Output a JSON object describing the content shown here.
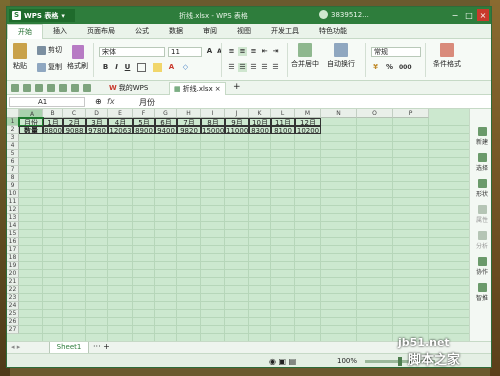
{
  "window": {
    "brand": "WPS 表格",
    "title": "折线.xlsx - WPS 表格",
    "user": "3839512...",
    "controls": [
      "minimize",
      "maximize",
      "close"
    ]
  },
  "menus": [
    "开始",
    "插入",
    "页面布局",
    "公式",
    "数据",
    "审阅",
    "视图",
    "开发工具",
    "特色功能"
  ],
  "ribbon": {
    "paste_label": "粘贴",
    "cut_label": "剪切",
    "copy_label": "复制",
    "format_painter_label": "格式刷",
    "font_name": "宋体",
    "font_size": "11",
    "merge_label": "合并居中",
    "wrap_label": "自动换行",
    "number_format": "常规",
    "conditional_format_label": "条件格式",
    "percent_symbol": "%"
  },
  "doc_tabs": [
    {
      "label": "我的WPS",
      "active": false
    },
    {
      "label": "折线.xlsx",
      "active": true
    }
  ],
  "formula_bar": {
    "cell_ref": "A1",
    "fx": "fx",
    "value": "月份"
  },
  "columns": [
    "A",
    "B",
    "C",
    "D",
    "E",
    "F",
    "G",
    "H",
    "I",
    "J",
    "K",
    "L",
    "M",
    "N",
    "O",
    "P"
  ],
  "rows": [
    "1",
    "2",
    "3",
    "4",
    "5",
    "6",
    "7",
    "8",
    "9",
    "10",
    "11",
    "12",
    "13",
    "14",
    "15",
    "16",
    "17",
    "18",
    "19",
    "20",
    "21",
    "22",
    "23",
    "24",
    "25",
    "26",
    "27"
  ],
  "table": {
    "headers": [
      "月份",
      "1月",
      "2月",
      "3月",
      "4月",
      "5月",
      "6月",
      "7月",
      "8月",
      "9月",
      "10月",
      "11月",
      "12月"
    ],
    "values": [
      "数量",
      "8800",
      "9088",
      "9780",
      "12063",
      "8900",
      "9400",
      "9820",
      "15000",
      "11000",
      "8300",
      "8100",
      "10200"
    ]
  },
  "side_panel": [
    "新建",
    "选择",
    "形状",
    "属性",
    "分析",
    "协作",
    "智推"
  ],
  "sheet_tabs": [
    "Sheet1"
  ],
  "status": {
    "zoom": "100%"
  },
  "watermark": {
    "line1": "jb51.net",
    "line2": "脚本之家"
  },
  "colors": {
    "title_bar": "#2e7d3c",
    "sheet_background": "#cce8cf",
    "accent": "#1e7a2e"
  }
}
